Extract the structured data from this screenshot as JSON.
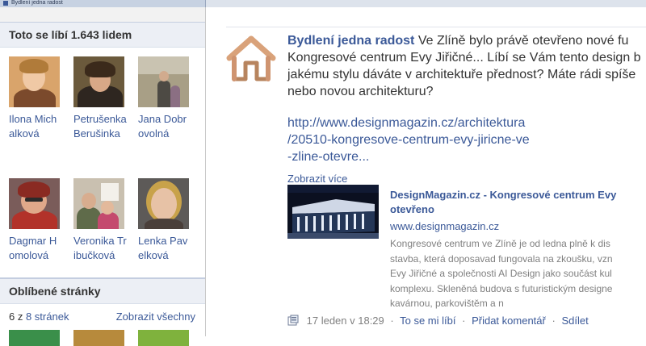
{
  "browser": {
    "tab_title": "Bydlení jedna radost"
  },
  "sidebar": {
    "likes_box": {
      "title": "Toto se líbí 1.643 lidem",
      "friends": [
        {
          "name": "Ilona Michalková"
        },
        {
          "name": "Petrušenka Berušinka"
        },
        {
          "name": "Jana Dobrovolná"
        },
        {
          "name": "Dagmar Homolová"
        },
        {
          "name": "Veronika Tribučková"
        },
        {
          "name": "Lenka Pavelková"
        }
      ]
    },
    "pages_box": {
      "title": "Oblíbené stránky",
      "count_prefix": "6 z",
      "count_link": "8 stránek",
      "show_all": "Zobrazit všechny"
    }
  },
  "post": {
    "author": "Bydlení jedna radost",
    "lines": [
      "Ve Zlíně bylo právě otevřeno nové fu",
      "Kongresové centrum Evy Jiřičné... Líbí se Vám tento design b",
      "jakému stylu dáváte v architektuře přednost? Máte rádi spíše",
      "nebo novou architekturu?"
    ],
    "link_lines": [
      "http://www.designmagazin.cz/architektura",
      "/20510-kongresove-centrum-evy-jiricne-ve",
      "-zline-otevre..."
    ],
    "show_more": "Zobrazit více",
    "attachment": {
      "title_line1": "DesignMagazin.cz - Kongresové centrum Evy",
      "title_line2": "otevřeno",
      "url": "www.designmagazin.cz",
      "desc_lines": [
        "Kongresové centrum ve Zlíně je od ledna plně k dis",
        "stavba, která doposavad fungovala na zkoušku, vzn",
        "Evy Jiřičné a společnosti AI Design jako součást kul",
        "komplexu. Skleněná budova s futuristickým designe",
        "kavárnou, parkovištěm a n"
      ]
    },
    "footer": {
      "time": "17 leden v 18:29",
      "like": "To se mi líbí",
      "comment": "Přidat komentář",
      "share": "Sdílet"
    }
  },
  "colors": {
    "link": "#3b5998",
    "header_bg": "#eceff5",
    "muted": "#808080"
  }
}
